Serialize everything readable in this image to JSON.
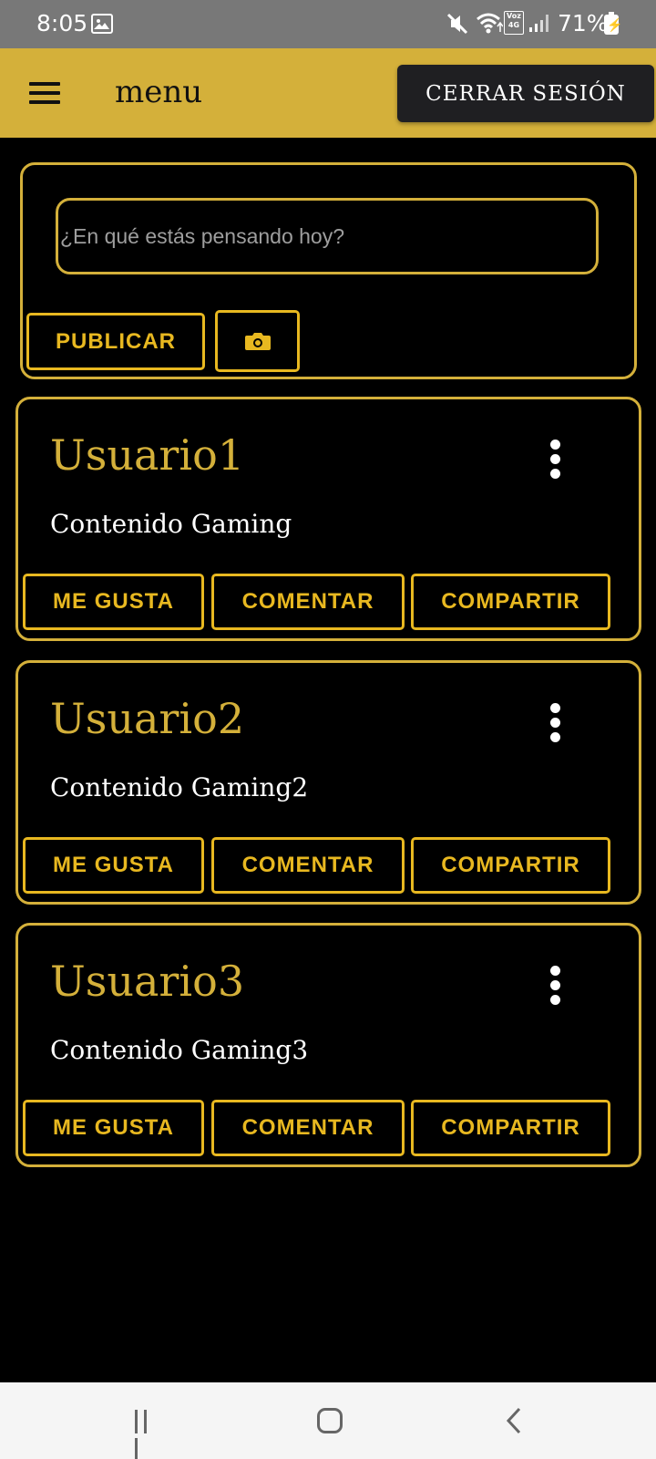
{
  "status_bar": {
    "time": "8:05",
    "battery": "71%",
    "network_badge": "Voz\n4G"
  },
  "app_bar": {
    "title": "menu",
    "logout_label": "CERRAR SESIÓN"
  },
  "composer": {
    "placeholder": "¿En qué estás pensando hoy?",
    "publish_label": "PUBLICAR",
    "camera_icon": "camera-icon"
  },
  "posts": [
    {
      "author": "Usuario1",
      "content": "Contenido Gaming",
      "like_label": "ME GUSTA",
      "comment_label": "COMENTAR",
      "share_label": "COMPARTIR"
    },
    {
      "author": "Usuario2",
      "content": "Contenido Gaming2",
      "like_label": "ME GUSTA",
      "comment_label": "COMENTAR",
      "share_label": "COMPARTIR"
    },
    {
      "author": "Usuario3",
      "content": "Contenido Gaming3",
      "like_label": "ME GUSTA",
      "comment_label": "COMENTAR",
      "share_label": "COMPARTIR"
    }
  ],
  "colors": {
    "accent": "#d4b03a",
    "button_gold": "#e8b820",
    "background": "#000000",
    "status_bar": "#787878"
  }
}
